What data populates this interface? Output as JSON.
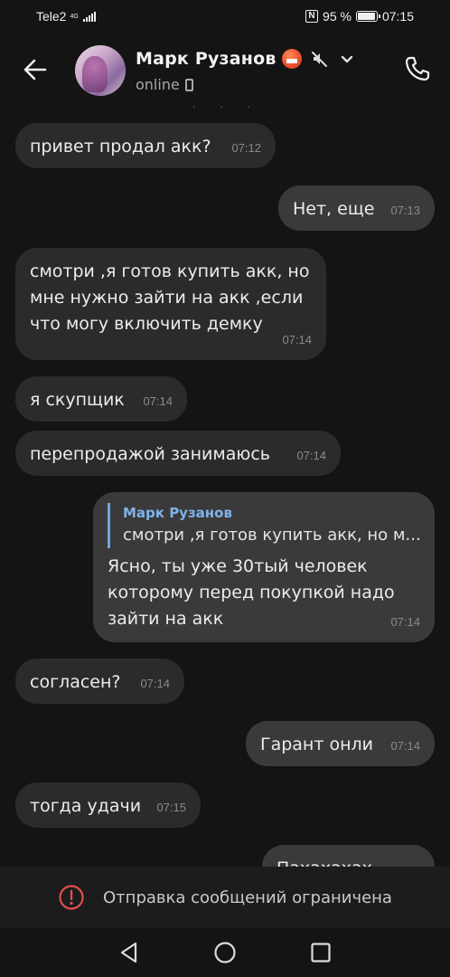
{
  "status_bar": {
    "carrier": "Tele2",
    "network_type": "4G",
    "battery": "95 %",
    "time": "07:15"
  },
  "header": {
    "contact_name": "Марк Рузанов",
    "status": "online"
  },
  "messages": [
    {
      "side": "in",
      "text": "привет продал акк?",
      "time": "07:12"
    },
    {
      "side": "out",
      "text": "Нет, еще",
      "time": "07:13"
    },
    {
      "side": "in",
      "lines": [
        "смотри ,я готов купить акк, но",
        "мне нужно зайти на акк ,если",
        "что могу включить демку"
      ],
      "time": "07:14"
    },
    {
      "side": "in",
      "text": "я скупщик",
      "time": "07:14"
    },
    {
      "side": "in",
      "text": "перепродажой занимаюсь",
      "time": "07:14"
    },
    {
      "side": "out",
      "reply_to": {
        "name": "Марк Рузанов",
        "text": "смотри ,я готов купить акк, но м..."
      },
      "lines": [
        "Ясно, ты уже 30тый человек",
        "которому перед покупкой надо",
        "зайти на акк"
      ],
      "time": "07:14"
    },
    {
      "side": "in",
      "text": "согласен?",
      "time": "07:14"
    },
    {
      "side": "out",
      "text": "Гарант онли",
      "time": "07:14"
    },
    {
      "side": "in",
      "text": "тогда удачи",
      "time": "07:15"
    },
    {
      "side": "out",
      "text": "Пахахахах",
      "time": ""
    }
  ],
  "restriction": {
    "text": "Отправка сообщений ограничена"
  },
  "colors": {
    "background": "#141414",
    "incoming_bubble": "#2b2b2b",
    "outgoing_bubble": "#3a3a3a",
    "reply_accent": "#6fa8e6",
    "warning_red": "#e0504c"
  }
}
